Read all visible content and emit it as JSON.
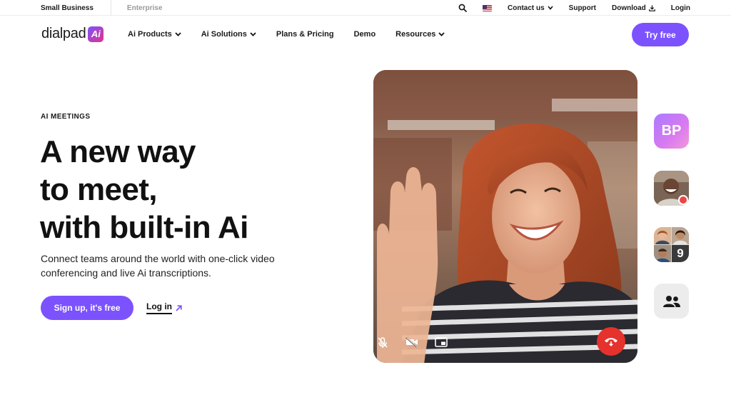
{
  "utility": {
    "tabs": [
      "Small Business",
      "Enterprise"
    ],
    "contact_label": "Contact us",
    "support_label": "Support",
    "download_label": "Download",
    "login_label": "Login"
  },
  "nav": {
    "logo_text": "dialpad",
    "logo_badge": "Ai",
    "items": [
      {
        "label": "Ai Products",
        "dropdown": true
      },
      {
        "label": "Ai Solutions",
        "dropdown": true
      },
      {
        "label": "Plans & Pricing",
        "dropdown": false
      },
      {
        "label": "Demo",
        "dropdown": false
      },
      {
        "label": "Resources",
        "dropdown": true
      }
    ],
    "cta_label": "Try free"
  },
  "hero": {
    "eyebrow": "AI MEETINGS",
    "headline": [
      "A new way",
      "to meet,",
      "with built-in Ai"
    ],
    "subtext": "Connect teams around the world with one-click video conferencing and live Ai transcriptions.",
    "primary_cta": "Sign up, it's free",
    "secondary_cta": "Log in"
  },
  "participants": {
    "initials": "BP",
    "overflow_count": "9"
  },
  "colors": {
    "brand_purple": "#7c52ff",
    "end_call_red": "#e5322d",
    "recording_red": "#ef4444"
  },
  "icons": [
    "search-icon",
    "us-flag-icon",
    "chevron-down-icon",
    "download-icon",
    "arrow-up-right-icon",
    "mic-off-icon",
    "camera-off-icon",
    "picture-in-picture-icon",
    "end-call-icon",
    "group-icon"
  ]
}
